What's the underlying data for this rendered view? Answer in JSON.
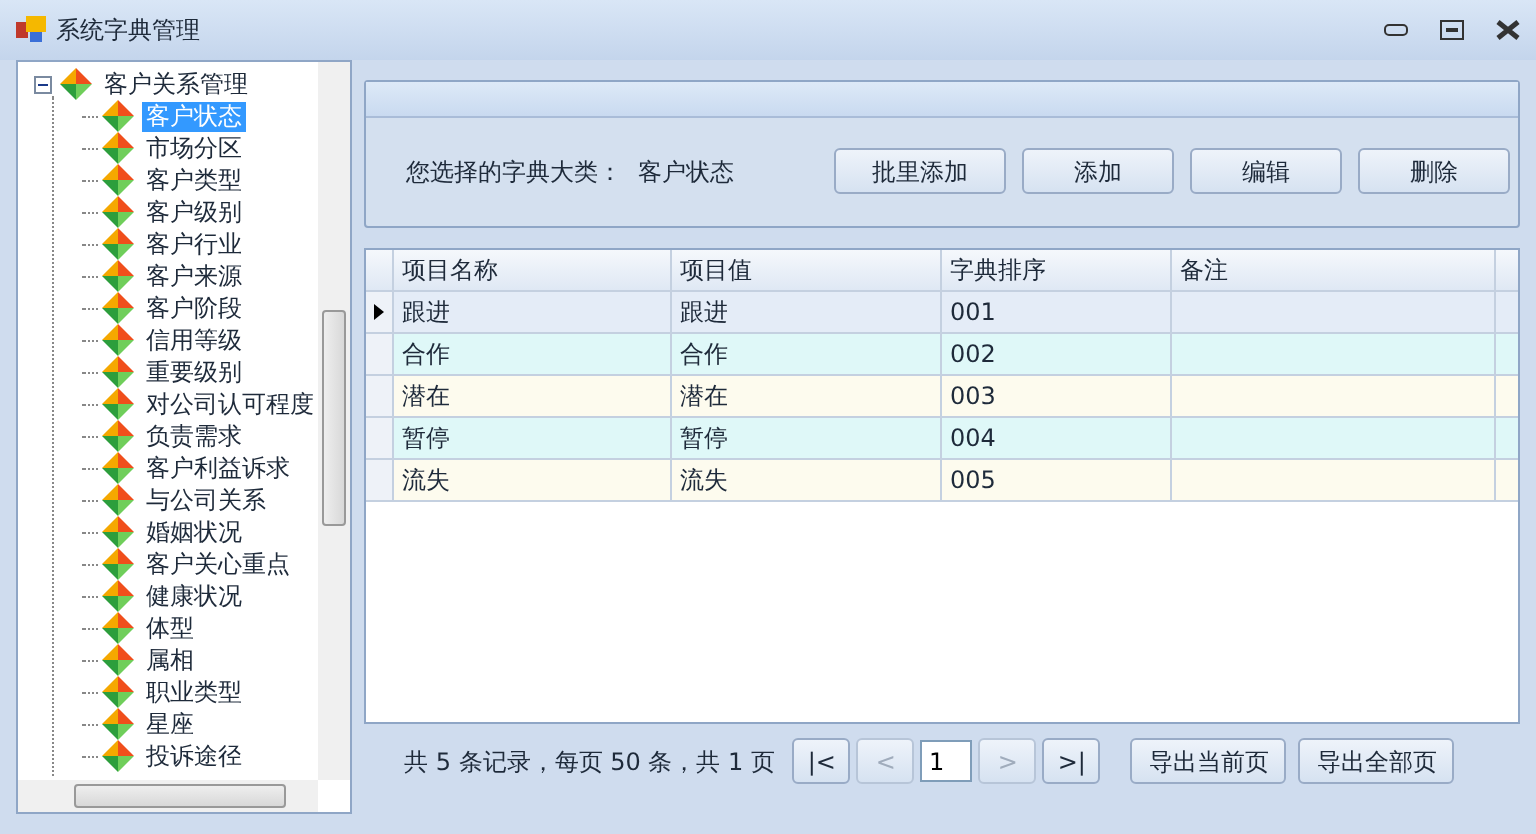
{
  "window": {
    "title": "系统字典管理"
  },
  "tree": {
    "label": "客户关系管理",
    "expanded": true,
    "children": [
      {
        "label": "客户状态",
        "selected": true
      },
      {
        "label": "市场分区",
        "selected": false
      },
      {
        "label": "客户类型",
        "selected": false
      },
      {
        "label": "客户级别",
        "selected": false
      },
      {
        "label": "客户行业",
        "selected": false
      },
      {
        "label": "客户来源",
        "selected": false
      },
      {
        "label": "客户阶段",
        "selected": false
      },
      {
        "label": "信用等级",
        "selected": false
      },
      {
        "label": "重要级别",
        "selected": false
      },
      {
        "label": "对公司认可程度",
        "selected": false
      },
      {
        "label": "负责需求",
        "selected": false
      },
      {
        "label": "客户利益诉求",
        "selected": false
      },
      {
        "label": "与公司关系",
        "selected": false
      },
      {
        "label": "婚姻状况",
        "selected": false
      },
      {
        "label": "客户关心重点",
        "selected": false
      },
      {
        "label": "健康状况",
        "selected": false
      },
      {
        "label": "体型",
        "selected": false
      },
      {
        "label": "属相",
        "selected": false
      },
      {
        "label": "职业类型",
        "selected": false
      },
      {
        "label": "星座",
        "selected": false
      },
      {
        "label": "投诉途径",
        "selected": false
      }
    ]
  },
  "panel": {
    "label": "您选择的字典大类：",
    "value": "客户状态",
    "buttons": [
      "批里添加",
      "添加",
      "编辑",
      "删除"
    ]
  },
  "table": {
    "columns": [
      "项目名称",
      "项目值",
      "字典排序",
      "备注"
    ],
    "rows": [
      {
        "cells": [
          "跟进",
          "跟进",
          "001",
          ""
        ],
        "selected": true
      },
      {
        "cells": [
          "合作",
          "合作",
          "002",
          ""
        ],
        "selected": false
      },
      {
        "cells": [
          "潜在",
          "潜在",
          "003",
          ""
        ],
        "selected": false
      },
      {
        "cells": [
          "暂停",
          "暂停",
          "004",
          ""
        ],
        "selected": false
      },
      {
        "cells": [
          "流失",
          "流失",
          "005",
          ""
        ],
        "selected": false
      }
    ]
  },
  "pager": {
    "summary": "共 5 条记录，每页 50 条，共 1 页",
    "nav": [
      {
        "label": "|<",
        "disabled": false
      },
      {
        "label": "<",
        "disabled": true
      },
      {
        "label": ">",
        "disabled": true
      },
      {
        "label": ">|",
        "disabled": false
      }
    ],
    "page": "1",
    "exports": [
      "导出当前页",
      "导出全部页"
    ]
  }
}
